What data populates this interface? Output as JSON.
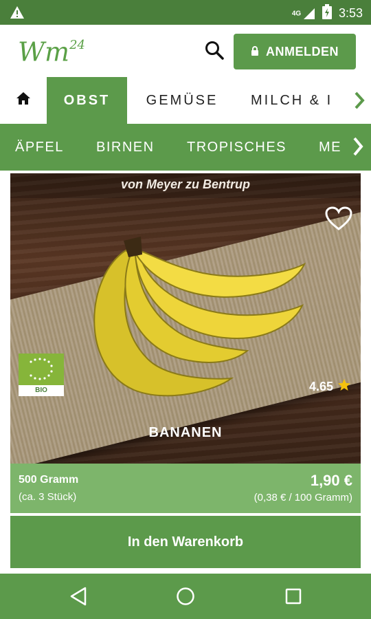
{
  "status": {
    "network": "4G",
    "time": "3:53"
  },
  "header": {
    "logo_text": "Wm",
    "logo_sup": "24",
    "login_label": "ANMELDEN"
  },
  "categories": [
    "OBST",
    "GEMÜSE",
    "MILCH & I"
  ],
  "subcategories": [
    "ÄPFEL",
    "BIRNEN",
    "TROPISCHES",
    "ME"
  ],
  "product": {
    "producer": "von Meyer zu Bentrup",
    "bio_label": "BIO",
    "rating": "4.65",
    "name": "BANANEN",
    "weight": "500 Gramm",
    "count": "(ca. 3 Stück)",
    "price": "1,90 €",
    "unit_price": "(0,38 € / 100 Gramm)"
  },
  "cart_label": "In den Warenkorb",
  "colors": {
    "brand_green": "#5c9a4b",
    "status_green": "#4a7f3b",
    "info_green": "#7db56b",
    "star": "#f4c20d"
  }
}
